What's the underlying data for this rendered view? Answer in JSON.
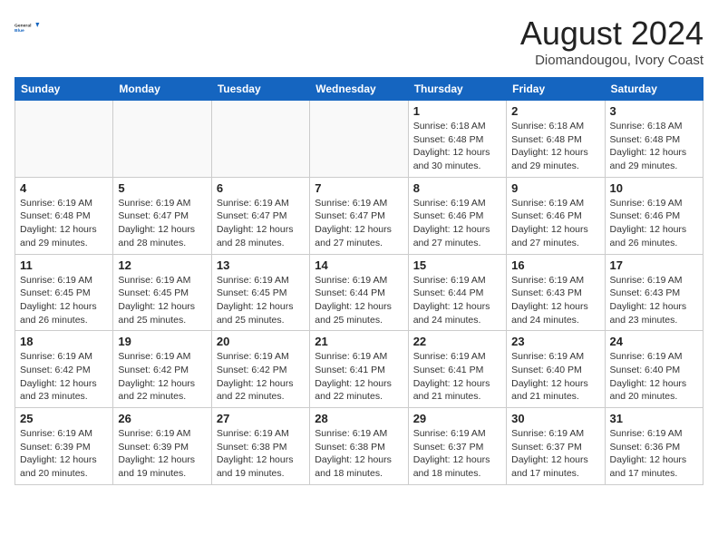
{
  "header": {
    "logo_line1": "General",
    "logo_line2": "Blue",
    "month_title": "August 2024",
    "location": "Diomandougou, Ivory Coast"
  },
  "days_of_week": [
    "Sunday",
    "Monday",
    "Tuesday",
    "Wednesday",
    "Thursday",
    "Friday",
    "Saturday"
  ],
  "weeks": [
    [
      {
        "day": "",
        "info": ""
      },
      {
        "day": "",
        "info": ""
      },
      {
        "day": "",
        "info": ""
      },
      {
        "day": "",
        "info": ""
      },
      {
        "day": "1",
        "info": "Sunrise: 6:18 AM\nSunset: 6:48 PM\nDaylight: 12 hours\nand 30 minutes."
      },
      {
        "day": "2",
        "info": "Sunrise: 6:18 AM\nSunset: 6:48 PM\nDaylight: 12 hours\nand 29 minutes."
      },
      {
        "day": "3",
        "info": "Sunrise: 6:18 AM\nSunset: 6:48 PM\nDaylight: 12 hours\nand 29 minutes."
      }
    ],
    [
      {
        "day": "4",
        "info": "Sunrise: 6:19 AM\nSunset: 6:48 PM\nDaylight: 12 hours\nand 29 minutes."
      },
      {
        "day": "5",
        "info": "Sunrise: 6:19 AM\nSunset: 6:47 PM\nDaylight: 12 hours\nand 28 minutes."
      },
      {
        "day": "6",
        "info": "Sunrise: 6:19 AM\nSunset: 6:47 PM\nDaylight: 12 hours\nand 28 minutes."
      },
      {
        "day": "7",
        "info": "Sunrise: 6:19 AM\nSunset: 6:47 PM\nDaylight: 12 hours\nand 27 minutes."
      },
      {
        "day": "8",
        "info": "Sunrise: 6:19 AM\nSunset: 6:46 PM\nDaylight: 12 hours\nand 27 minutes."
      },
      {
        "day": "9",
        "info": "Sunrise: 6:19 AM\nSunset: 6:46 PM\nDaylight: 12 hours\nand 27 minutes."
      },
      {
        "day": "10",
        "info": "Sunrise: 6:19 AM\nSunset: 6:46 PM\nDaylight: 12 hours\nand 26 minutes."
      }
    ],
    [
      {
        "day": "11",
        "info": "Sunrise: 6:19 AM\nSunset: 6:45 PM\nDaylight: 12 hours\nand 26 minutes."
      },
      {
        "day": "12",
        "info": "Sunrise: 6:19 AM\nSunset: 6:45 PM\nDaylight: 12 hours\nand 25 minutes."
      },
      {
        "day": "13",
        "info": "Sunrise: 6:19 AM\nSunset: 6:45 PM\nDaylight: 12 hours\nand 25 minutes."
      },
      {
        "day": "14",
        "info": "Sunrise: 6:19 AM\nSunset: 6:44 PM\nDaylight: 12 hours\nand 25 minutes."
      },
      {
        "day": "15",
        "info": "Sunrise: 6:19 AM\nSunset: 6:44 PM\nDaylight: 12 hours\nand 24 minutes."
      },
      {
        "day": "16",
        "info": "Sunrise: 6:19 AM\nSunset: 6:43 PM\nDaylight: 12 hours\nand 24 minutes."
      },
      {
        "day": "17",
        "info": "Sunrise: 6:19 AM\nSunset: 6:43 PM\nDaylight: 12 hours\nand 23 minutes."
      }
    ],
    [
      {
        "day": "18",
        "info": "Sunrise: 6:19 AM\nSunset: 6:42 PM\nDaylight: 12 hours\nand 23 minutes."
      },
      {
        "day": "19",
        "info": "Sunrise: 6:19 AM\nSunset: 6:42 PM\nDaylight: 12 hours\nand 22 minutes."
      },
      {
        "day": "20",
        "info": "Sunrise: 6:19 AM\nSunset: 6:42 PM\nDaylight: 12 hours\nand 22 minutes."
      },
      {
        "day": "21",
        "info": "Sunrise: 6:19 AM\nSunset: 6:41 PM\nDaylight: 12 hours\nand 22 minutes."
      },
      {
        "day": "22",
        "info": "Sunrise: 6:19 AM\nSunset: 6:41 PM\nDaylight: 12 hours\nand 21 minutes."
      },
      {
        "day": "23",
        "info": "Sunrise: 6:19 AM\nSunset: 6:40 PM\nDaylight: 12 hours\nand 21 minutes."
      },
      {
        "day": "24",
        "info": "Sunrise: 6:19 AM\nSunset: 6:40 PM\nDaylight: 12 hours\nand 20 minutes."
      }
    ],
    [
      {
        "day": "25",
        "info": "Sunrise: 6:19 AM\nSunset: 6:39 PM\nDaylight: 12 hours\nand 20 minutes."
      },
      {
        "day": "26",
        "info": "Sunrise: 6:19 AM\nSunset: 6:39 PM\nDaylight: 12 hours\nand 19 minutes."
      },
      {
        "day": "27",
        "info": "Sunrise: 6:19 AM\nSunset: 6:38 PM\nDaylight: 12 hours\nand 19 minutes."
      },
      {
        "day": "28",
        "info": "Sunrise: 6:19 AM\nSunset: 6:38 PM\nDaylight: 12 hours\nand 18 minutes."
      },
      {
        "day": "29",
        "info": "Sunrise: 6:19 AM\nSunset: 6:37 PM\nDaylight: 12 hours\nand 18 minutes."
      },
      {
        "day": "30",
        "info": "Sunrise: 6:19 AM\nSunset: 6:37 PM\nDaylight: 12 hours\nand 17 minutes."
      },
      {
        "day": "31",
        "info": "Sunrise: 6:19 AM\nSunset: 6:36 PM\nDaylight: 12 hours\nand 17 minutes."
      }
    ]
  ]
}
